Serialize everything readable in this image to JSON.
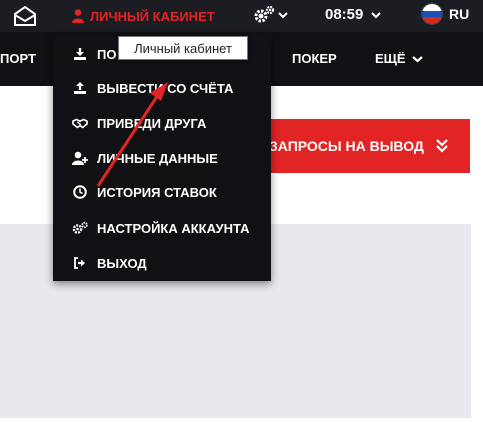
{
  "topbar": {
    "cabinet_label": "ЛИЧНЫЙ КАБИНЕТ",
    "time": "08:59",
    "language": "RU"
  },
  "nav": {
    "sport": "ПОРТ",
    "poker": "ПОКЕР",
    "more": "ЕЩЁ"
  },
  "dropdown": {
    "items": [
      {
        "label": "ПО",
        "icon": "download-icon"
      },
      {
        "label": "ВЫВЕСТИ СО СЧЁТА",
        "icon": "upload-icon"
      },
      {
        "label": "ПРИВЕДИ ДРУГА",
        "icon": "handshake-icon"
      },
      {
        "label": "ЛИЧНЫЕ ДАННЫЕ",
        "icon": "user-plus-icon"
      },
      {
        "label": "ИСТОРИЯ СТАВОК",
        "icon": "clock-icon"
      },
      {
        "label": "НАСТРОЙКА АККАУНТА",
        "icon": "gears-icon"
      },
      {
        "label": "ВЫХОД",
        "icon": "sign-out-icon"
      }
    ]
  },
  "tooltip": "Личный кабинет",
  "withdraw_button": "ЗАПРОСЫ НА ВЫВОД",
  "colors": {
    "accent": "#e32424",
    "topbar": "#1c1c23",
    "nav": "#111115",
    "panel": "#e9e8ee"
  }
}
